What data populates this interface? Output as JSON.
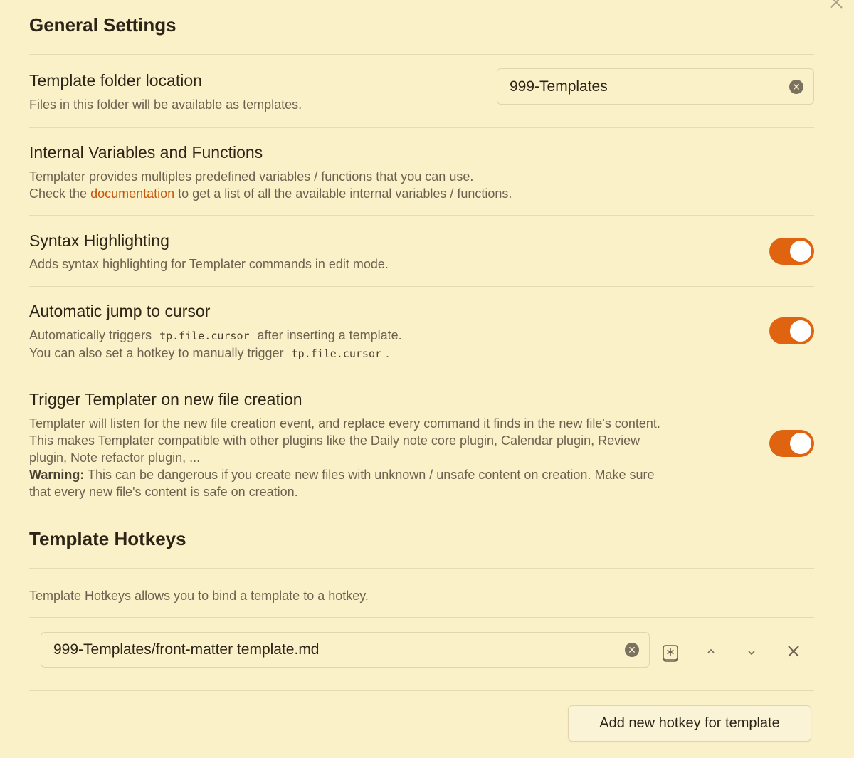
{
  "modal": {
    "close_icon": "close-icon"
  },
  "general": {
    "title": "General Settings",
    "template_folder": {
      "name": "Template folder location",
      "desc": "Files in this folder will be available as templates.",
      "value": "999-Templates"
    },
    "internal_vars": {
      "name": "Internal Variables and Functions",
      "desc_line1": "Templater provides multiples predefined variables / functions that you can use.",
      "desc_line2_prefix": "Check the",
      "desc_link": "documentation",
      "desc_line2_suffix": "to get a list of all the available internal variables / functions."
    },
    "syntax": {
      "name": "Syntax Highlighting",
      "desc": "Adds syntax highlighting for Templater commands in edit mode.",
      "enabled": true
    },
    "jump_cursor": {
      "name": "Automatic jump to cursor",
      "line1_prefix": "Automatically triggers",
      "code": "tp.file.cursor",
      "line1_suffix": "after inserting a template.",
      "line2_prefix": "You can also set a hotkey to manually trigger",
      "line2_suffix": ".",
      "enabled": true
    },
    "trigger_new": {
      "name": "Trigger Templater on new file creation",
      "line1": "Templater will listen for the new file creation event, and replace every command it finds in the new file's content.",
      "line2": "This makes Templater compatible with other plugins like the Daily note core plugin, Calendar plugin, Review",
      "line3": "plugin, Note refactor plugin, ...",
      "warning_label": "Warning:",
      "warning_text": "This can be dangerous if you create new files with unknown / unsafe content on creation. Make sure",
      "line5": "that every new file's content is safe on creation.",
      "enabled": true
    }
  },
  "hotkeys": {
    "title": "Template Hotkeys",
    "desc": "Template Hotkeys allows you to bind a template to a hotkey.",
    "items": [
      {
        "value": "999-Templates/front-matter template.md"
      }
    ],
    "add_button": "Add new hotkey for template"
  },
  "colors": {
    "accent": "#e0640f",
    "background": "#fbf1c9"
  }
}
